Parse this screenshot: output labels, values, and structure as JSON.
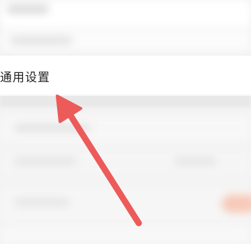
{
  "settings": {
    "general_label": "通用设置"
  },
  "colors": {
    "arrow": "#ec5a5a",
    "row_background": "#ffffff",
    "page_background": "#f3f3f3",
    "accent_blur": "#f7c9b8"
  },
  "icons": {
    "pointer": "arrow-pointer-icon"
  }
}
